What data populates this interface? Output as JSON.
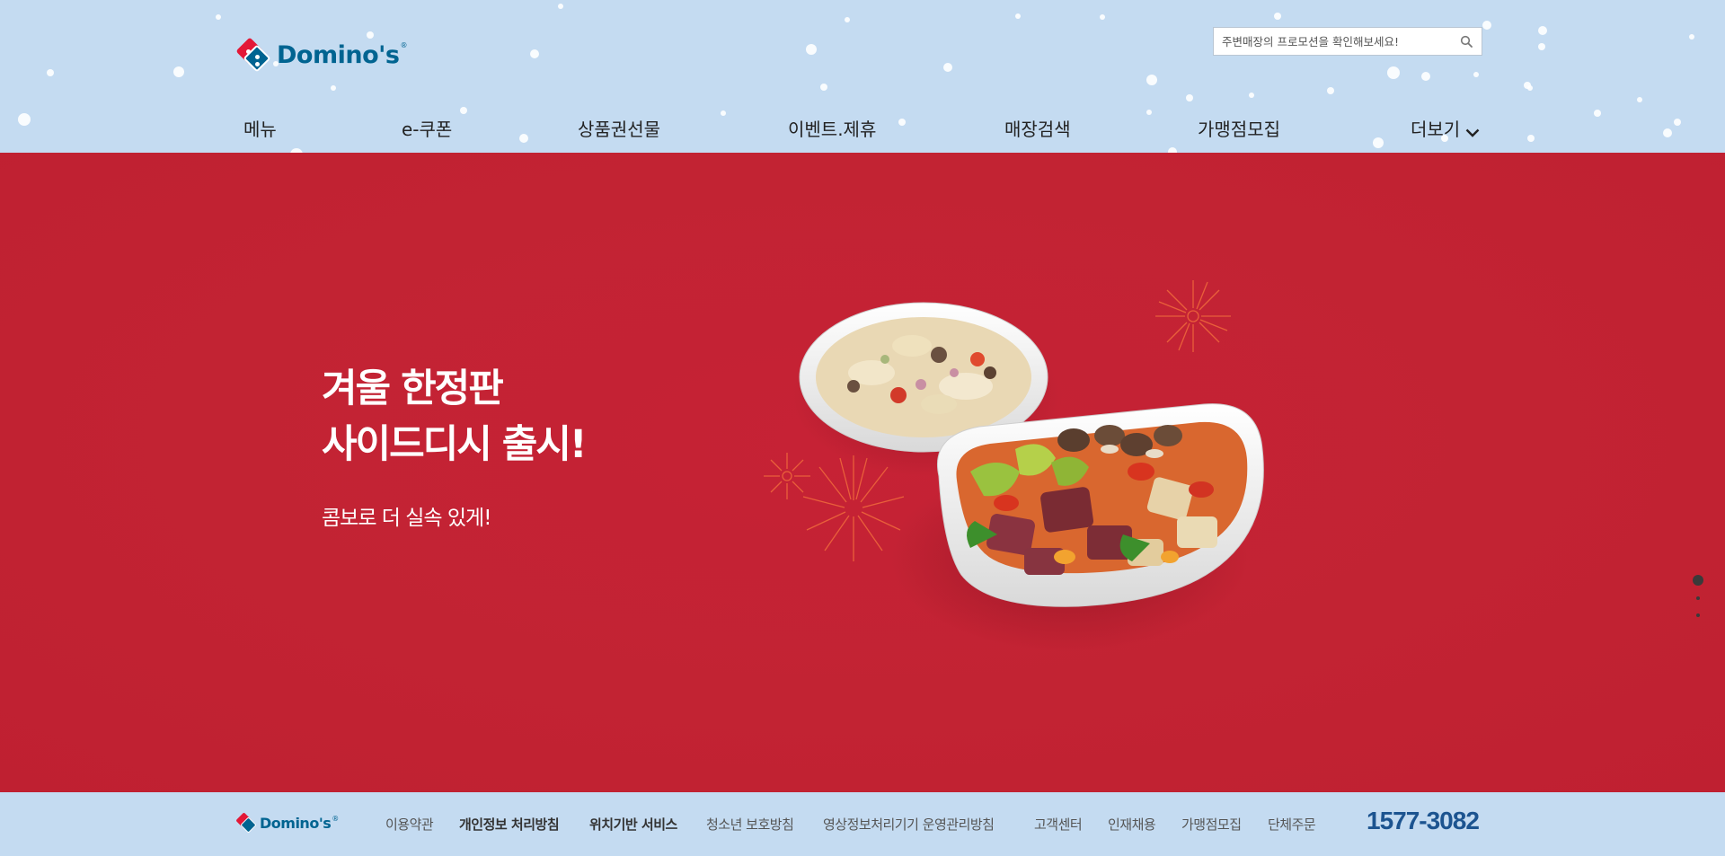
{
  "header": {
    "logo_text": "Domino's",
    "search_placeholder": "주변매장의 프로모션을 확인해보세요!"
  },
  "nav": {
    "items": [
      {
        "label": "메뉴"
      },
      {
        "label": "e-쿠폰"
      },
      {
        "label": "상품권선물"
      },
      {
        "label": "이벤트.제휴"
      },
      {
        "label": "매장검색"
      },
      {
        "label": "가맹점모집"
      },
      {
        "label": "더보기"
      }
    ]
  },
  "hero": {
    "title_line1": "겨울 한정판",
    "title_line2": "사이드디시 출시!",
    "subtitle": "콤보로 더 실속 있게!"
  },
  "slider": {
    "total": 3,
    "active": 1
  },
  "footer": {
    "logo_text": "Domino's",
    "links": [
      {
        "label": "이용약관",
        "bold": false
      },
      {
        "label": "개인정보 처리방침",
        "bold": true
      },
      {
        "label": "위치기반 서비스",
        "bold": true
      },
      {
        "label": "청소년 보호방침",
        "bold": false
      },
      {
        "label": "영상정보처리기기 운영관리방침",
        "bold": false
      },
      {
        "label": "고객센터",
        "bold": false
      },
      {
        "label": "인재채용",
        "bold": false
      },
      {
        "label": "가맹점모집",
        "bold": false
      },
      {
        "label": "단체주문",
        "bold": false
      }
    ],
    "phone": "1577-3082"
  },
  "colors": {
    "header_bg": "#c4dbf1",
    "hero_bg": "#c42334",
    "brand_blue": "#006491",
    "brand_red": "#e31837",
    "phone_blue": "#1c5490"
  }
}
